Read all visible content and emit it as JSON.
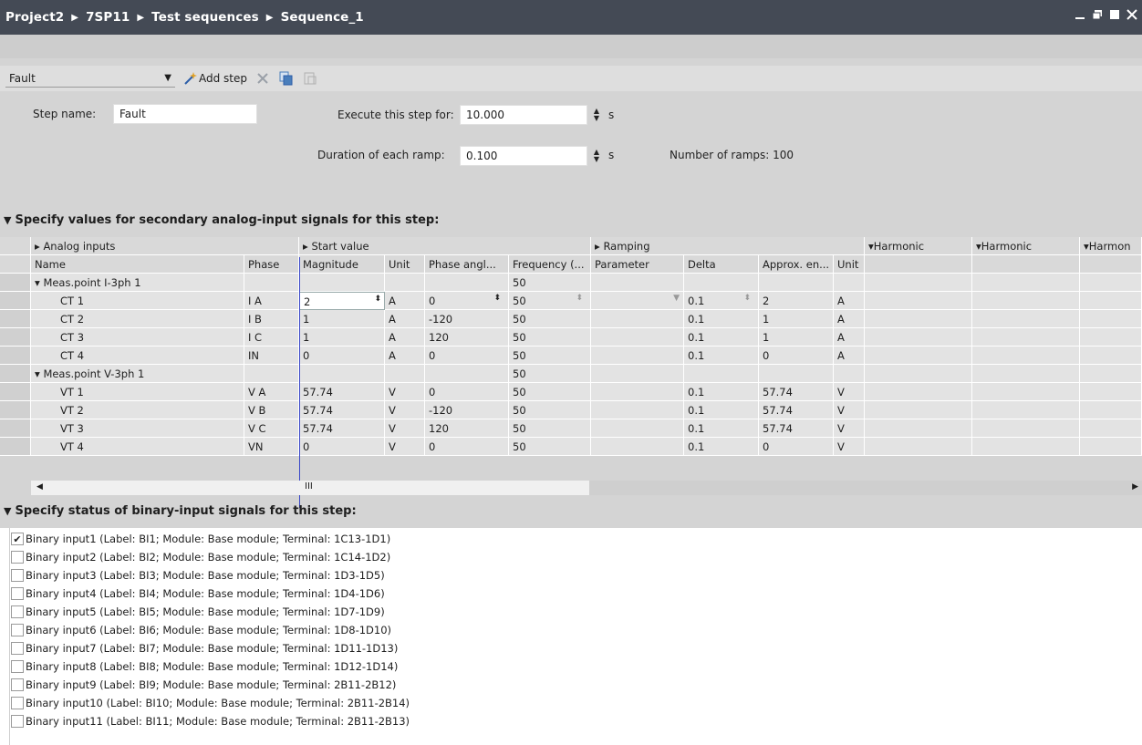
{
  "titlebar": {
    "crumbs": [
      "Project2",
      "7SP11",
      "Test sequences",
      "Sequence_1"
    ],
    "controls": [
      "minimize-icon",
      "restore-icon",
      "maximize-icon",
      "close-icon"
    ]
  },
  "toolbar": {
    "sequence_select": "Fault",
    "add_step_label": "Add step"
  },
  "step": {
    "name_label": "Step name:",
    "name_value": "Fault",
    "execute_label": "Execute this step for:",
    "execute_value": "10.000",
    "execute_unit": "s",
    "ramp_label": "Duration of each ramp:",
    "ramp_value": "0.100",
    "ramp_unit": "s",
    "ramps_count": "Number of ramps: 100"
  },
  "analog_section": {
    "title": "Specify values for secondary analog-input signals for this step:",
    "groups": [
      "Analog inputs",
      "Start value",
      "Ramping",
      "Harmonic",
      "Harmonic",
      "Harmon"
    ],
    "columns": [
      "Name",
      "Phase",
      "Magnitude",
      "Unit",
      "Phase angl...",
      "Frequency (...",
      "Parameter",
      "Delta",
      "Approx. en...",
      "Unit"
    ],
    "rows": [
      {
        "name": "Meas.point I-3ph 1",
        "phase": "",
        "magnitude": "",
        "unit": "",
        "angle": "",
        "freq": "50",
        "param": "",
        "delta": "",
        "approx": "",
        "unit2": "",
        "group": true
      },
      {
        "name": "CT 1",
        "phase": "I A",
        "magnitude": "2",
        "unit": "A",
        "angle": "0",
        "freq": "50",
        "param": "",
        "delta": "0.1",
        "approx": "2",
        "unit2": "A"
      },
      {
        "name": "CT 2",
        "phase": "I B",
        "magnitude": "1",
        "unit": "A",
        "angle": "-120",
        "freq": "50",
        "param": "",
        "delta": "0.1",
        "approx": "1",
        "unit2": "A"
      },
      {
        "name": "CT 3",
        "phase": "I C",
        "magnitude": "1",
        "unit": "A",
        "angle": "120",
        "freq": "50",
        "param": "",
        "delta": "0.1",
        "approx": "1",
        "unit2": "A"
      },
      {
        "name": "CT 4",
        "phase": "IN",
        "magnitude": "0",
        "unit": "A",
        "angle": "0",
        "freq": "50",
        "param": "",
        "delta": "0.1",
        "approx": "0",
        "unit2": "A"
      },
      {
        "name": "Meas.point V-3ph 1",
        "phase": "",
        "magnitude": "",
        "unit": "",
        "angle": "",
        "freq": "50",
        "param": "",
        "delta": "",
        "approx": "",
        "unit2": "",
        "group": true
      },
      {
        "name": "VT 1",
        "phase": "V A",
        "magnitude": "57.74",
        "unit": "V",
        "angle": "0",
        "freq": "50",
        "param": "",
        "delta": "0.1",
        "approx": "57.74",
        "unit2": "V"
      },
      {
        "name": "VT 2",
        "phase": "V B",
        "magnitude": "57.74",
        "unit": "V",
        "angle": "-120",
        "freq": "50",
        "param": "",
        "delta": "0.1",
        "approx": "57.74",
        "unit2": "V"
      },
      {
        "name": "VT 3",
        "phase": "V C",
        "magnitude": "57.74",
        "unit": "V",
        "angle": "120",
        "freq": "50",
        "param": "",
        "delta": "0.1",
        "approx": "57.74",
        "unit2": "V"
      },
      {
        "name": "VT 4",
        "phase": "VN",
        "magnitude": "0",
        "unit": "V",
        "angle": "0",
        "freq": "50",
        "param": "",
        "delta": "0.1",
        "approx": "0",
        "unit2": "V"
      }
    ],
    "scroll_thumb_label": "III"
  },
  "binary_section": {
    "title": "Specify status of binary-input signals for this step:",
    "items": [
      {
        "label": "Binary input1 (Label: BI1; Module: Base module; Terminal: 1C13-1D1)",
        "checked": true
      },
      {
        "label": "Binary input2 (Label: BI2; Module: Base module; Terminal: 1C14-1D2)",
        "checked": false
      },
      {
        "label": "Binary input3 (Label: BI3; Module: Base module; Terminal: 1D3-1D5)",
        "checked": false
      },
      {
        "label": "Binary input4 (Label: BI4; Module: Base module; Terminal: 1D4-1D6)",
        "checked": false
      },
      {
        "label": "Binary input5 (Label: BI5; Module: Base module; Terminal: 1D7-1D9)",
        "checked": false
      },
      {
        "label": "Binary input6 (Label: BI6; Module: Base module; Terminal: 1D8-1D10)",
        "checked": false
      },
      {
        "label": "Binary input7 (Label: BI7; Module: Base module; Terminal: 1D11-1D13)",
        "checked": false
      },
      {
        "label": "Binary input8 (Label: BI8; Module: Base module; Terminal: 1D12-1D14)",
        "checked": false
      },
      {
        "label": "Binary input9 (Label: BI9; Module: Base module; Terminal: 2B11-2B12)",
        "checked": false
      },
      {
        "label": "Binary input10 (Label: BI10; Module: Base module; Terminal: 2B11-2B14)",
        "checked": false
      },
      {
        "label": "Binary input11 (Label: BI11; Module: Base module; Terminal: 2B11-2B13)",
        "checked": false
      }
    ]
  }
}
